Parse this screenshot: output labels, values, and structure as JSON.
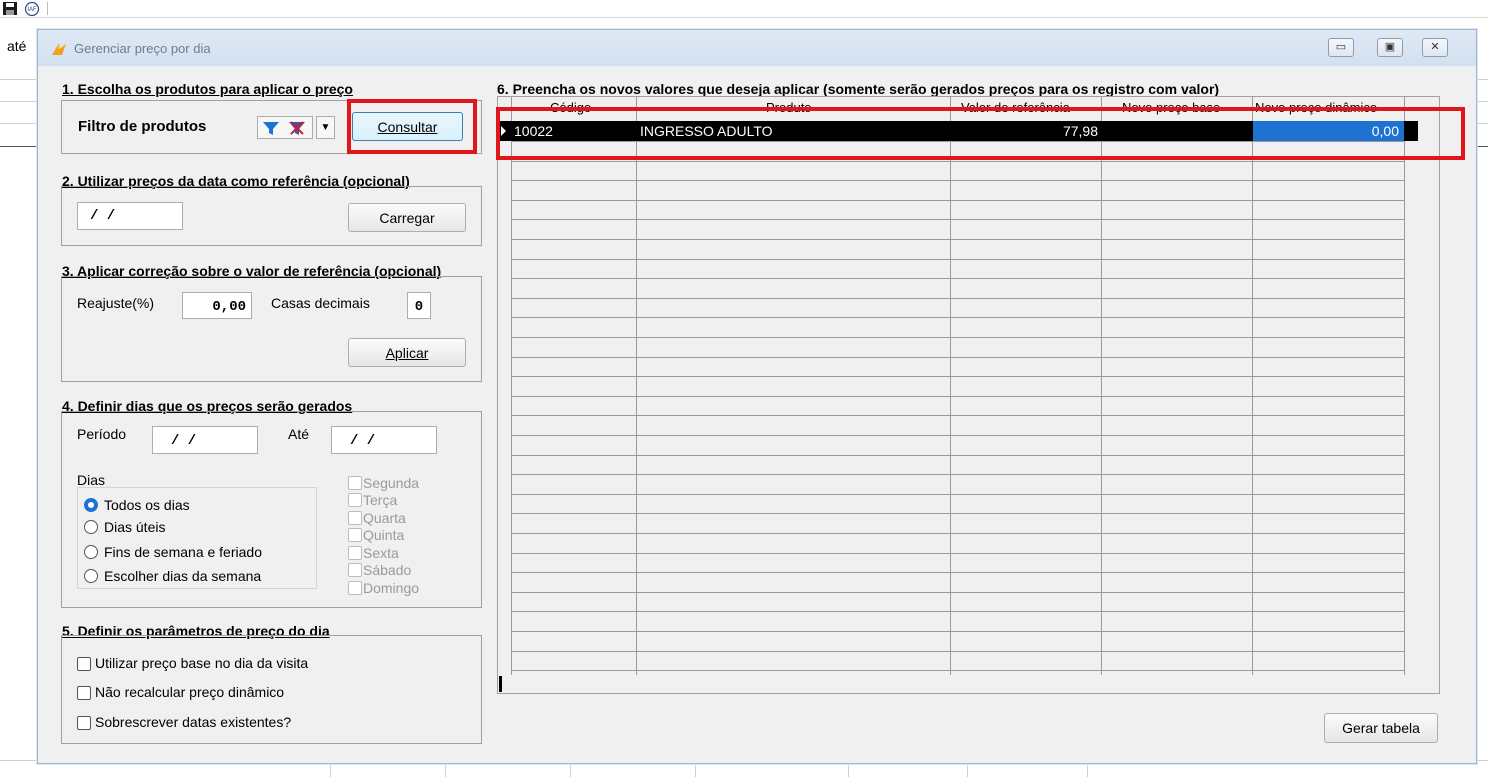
{
  "background": {
    "partial_label": "até"
  },
  "dialog": {
    "title": "Gerenciar preço por dia",
    "section1": {
      "title": "1. Escolha os produtos para aplicar o preço",
      "filter_label": "Filtro de produtos",
      "consult_button": "Consultar"
    },
    "section2": {
      "title": "2. Utilizar preços da data como referência (opcional)",
      "date_value": " /  /",
      "load_button": "Carregar"
    },
    "section3": {
      "title": "3. Aplicar correção sobre o valor de referência (opcional)",
      "reajuste_label": "Reajuste(%)",
      "reajuste_value": "0,00",
      "decimals_label": "Casas decimais",
      "decimals_value": "0",
      "apply_button": "Aplicar"
    },
    "section4": {
      "title": "4. Definir dias que os preços serão gerados",
      "period_label": "Período",
      "period_from": " /  /",
      "until_label": "Até",
      "period_to": " /  /",
      "days_label": "Dias",
      "day_options": [
        "Todos os dias",
        "Dias úteis",
        "Fins de semana e feriado",
        "Escolher dias da semana"
      ],
      "selected_option": "Todos os dias",
      "weekdays": [
        "Segunda",
        "Terça",
        "Quarta",
        "Quinta",
        "Sexta",
        "Sábado",
        "Domingo"
      ]
    },
    "section5": {
      "title": "5. Definir os parâmetros de preço do dia",
      "options": [
        "Utilizar preço base no dia da visita",
        "Não recalcular preço dinâmico",
        "Sobrescrever datas existentes?"
      ]
    },
    "section6": {
      "title": "6. Preencha os novos valores que deseja aplicar (somente serão gerados preços para os registro com valor)",
      "columns": [
        "Código",
        "Produto",
        "Valor de referência",
        "Novo preço base",
        "Novo preço dinâmico"
      ],
      "rows": [
        {
          "codigo": "10022",
          "produto": "INGRESSO ADULTO",
          "valor_ref": "77,98",
          "novo_base": "",
          "novo_dinamico": "0,00"
        }
      ]
    },
    "generate_button": "Gerar tabela"
  },
  "colors": {
    "highlight_box": "#e0161c",
    "selected_cell": "#1e73d2",
    "row_selected": "#000000"
  }
}
